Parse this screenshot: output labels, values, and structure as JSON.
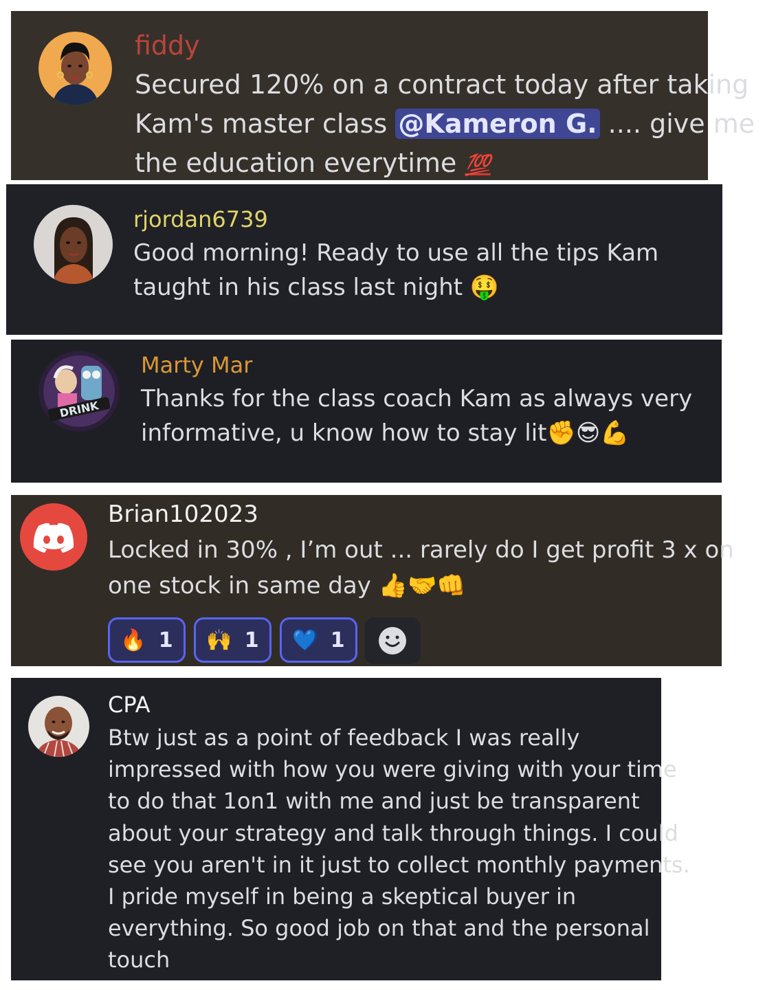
{
  "messages": [
    {
      "username": "fiddy",
      "username_color": "#b9443b",
      "avatar": "woman-avatar-icon",
      "lines": [
        {
          "text": "Secured 120% on a contract today after taking"
        },
        {
          "pre": "Kam's master class ",
          "mention": "@Kameron G.",
          "post": " .... give me"
        },
        {
          "text": "the education everytime ",
          "emoji": "💯"
        }
      ]
    },
    {
      "username": "rjordan6739",
      "username_color": "#e1d46a",
      "avatar": "woman-photo-avatar-icon",
      "lines": [
        "Good morning! Ready to use all the tips Kam",
        "taught in his class last night 🤑"
      ]
    },
    {
      "username": "Marty Mar",
      "username_color": "#d99837",
      "avatar": "cartoon-drink-avatar-icon",
      "avatar_text": "DRINK",
      "lines": [
        "Thanks for the class coach Kam as always very",
        "informative, u know how to stay lit✊😎💪"
      ]
    },
    {
      "username": "Brian102023",
      "username_color": "#f2f2f2",
      "avatar": "discord-logo-icon",
      "lines": [
        "Locked in 30% , I’m out ... rarely do I get profit 3 x on",
        "one stock in same day 👍🤝👊"
      ],
      "reactions": [
        {
          "emoji": "🔥",
          "count": "1",
          "icon": "fire-icon"
        },
        {
          "emoji": "🙌",
          "count": "1",
          "icon": "raised-hands-icon"
        },
        {
          "emoji": "💙",
          "count": "1",
          "icon": "blue-heart-icon"
        }
      ],
      "add_reaction_icon": "smiley-add-reaction-icon"
    },
    {
      "username": "CPA",
      "username_color": "#f2f2f2",
      "avatar": "man-photo-avatar-icon",
      "lines": [
        "Btw just as a point of feedback I was really",
        "impressed with how you were giving with your time",
        "to do that 1on1 with me and just be transparent",
        "about your strategy and talk through things. I could",
        "see you aren't in it just to collect monthly payments.",
        "I pride myself in being a skeptical buyer in",
        "everything. So good job on that and the personal",
        "touch"
      ]
    }
  ],
  "colors": {
    "mention_bg": "#3f4694",
    "reaction_border": "#5865f2",
    "discord_red": "#e5483f"
  }
}
